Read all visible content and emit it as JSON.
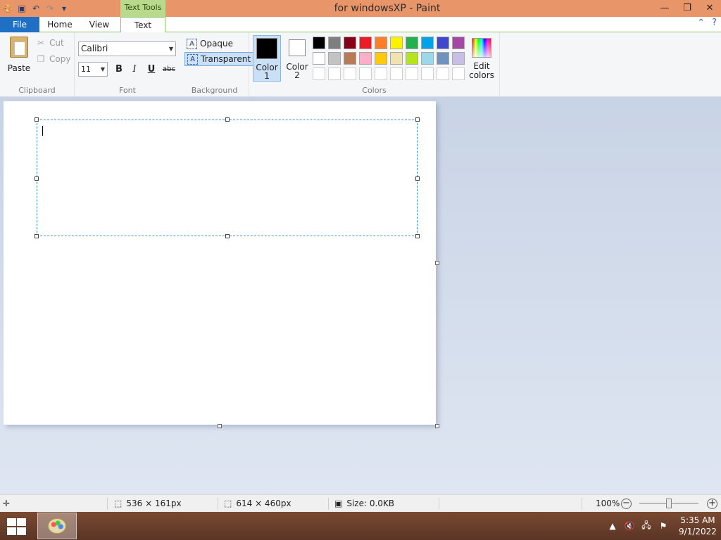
{
  "window": {
    "title": "for windowsXP - Paint",
    "context_tab": "Text Tools",
    "controls": [
      "—",
      "❐",
      "✕"
    ]
  },
  "tabs": {
    "file": "File",
    "home": "Home",
    "view": "View",
    "text": "Text"
  },
  "clipboard": {
    "paste": "Paste",
    "cut": "Cut",
    "copy": "Copy",
    "label": "Clipboard"
  },
  "font": {
    "name": "Calibri",
    "size": "11",
    "bold": "B",
    "italic": "I",
    "underline": "U",
    "strike": "abc",
    "label": "Font"
  },
  "background": {
    "opaque": "Opaque",
    "transparent": "Transparent",
    "label": "Background",
    "selected": "transparent"
  },
  "colors": {
    "color1_a": "Color",
    "color1_b": "1",
    "color1_value": "#000000",
    "color2_a": "Color",
    "color2_b": "2",
    "color2_value": "#ffffff",
    "label": "Colors",
    "edit_a": "Edit",
    "edit_b": "colors",
    "palette": [
      "#000000",
      "#7f7f7f",
      "#880015",
      "#ed1c24",
      "#ff7f27",
      "#fff200",
      "#22b14c",
      "#00a2e8",
      "#3f48cc",
      "#a349a4",
      "#ffffff",
      "#c3c3c3",
      "#b97a57",
      "#ffaec9",
      "#ffc90e",
      "#efe4b0",
      "#b5e61d",
      "#99d9ea",
      "#7092be",
      "#c8bfe7",
      "#ffffff",
      "#ffffff",
      "#ffffff",
      "#ffffff",
      "#ffffff",
      "#ffffff",
      "#ffffff",
      "#ffffff",
      "#ffffff",
      "#ffffff"
    ]
  },
  "status": {
    "selection_size": "536 × 161px",
    "canvas_size": "614 × 460px",
    "file_size": "Size: 0.0KB",
    "zoom": "100%"
  },
  "taskbar": {
    "time": "5:35 AM",
    "date": "9/1/2022"
  }
}
